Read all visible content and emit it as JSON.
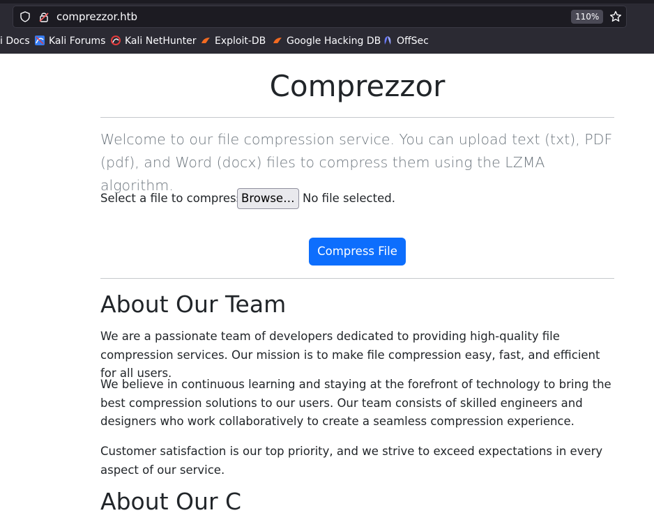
{
  "browser": {
    "url": "comprezzor.htb",
    "zoom": "110%",
    "bookmarks": [
      {
        "label": "i Docs",
        "icon": "docs-icon"
      },
      {
        "label": "Kali Forums",
        "icon": "kali-forums-icon"
      },
      {
        "label": "Kali NetHunter",
        "icon": "nethunter-icon"
      },
      {
        "label": "Exploit-DB",
        "icon": "exploit-db-icon"
      },
      {
        "label": "Google Hacking DB",
        "icon": "ghdb-icon"
      },
      {
        "label": "OffSec",
        "icon": "offsec-icon"
      }
    ]
  },
  "page": {
    "title": "Comprezzor",
    "lead": "Welcome to our file compression service. You can upload text (txt), PDF (pdf), and Word (docx) files to compress them using the LZMA algorithm.",
    "file_label": "Select a file to compress:",
    "browse_label": "Browse…",
    "no_file": "No file selected.",
    "submit_label": "Compress File",
    "about_heading": "About Our Team",
    "paragraphs": [
      "We are a passionate team of developers dedicated to providing high-quality file compression services. Our mission is to make file compression easy, fast, and efficient for all users.",
      "We believe in continuous learning and staying at the forefront of technology to bring the best compression solutions to our users. Our team consists of skilled engineers and designers who work collaboratively to create a seamless compression experience.",
      "Customer satisfaction is our top priority, and we strive to exceed expectations in every aspect of our service."
    ],
    "next_heading": "About Our C"
  },
  "colors": {
    "primary": "#0d6efd",
    "chrome": "#2b2a33",
    "muted": "#6c757d"
  }
}
